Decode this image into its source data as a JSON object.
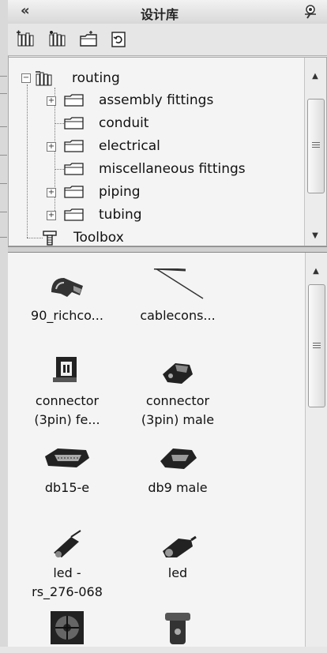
{
  "header": {
    "collapse_glyph": "«",
    "title": "设计库",
    "pin_icon": "pushpin-icon"
  },
  "toolbar": {
    "buttons": [
      {
        "name": "add-to-library-button",
        "icon": "library-add-icon"
      },
      {
        "name": "add-file-location-button",
        "icon": "library-location-icon"
      },
      {
        "name": "create-new-folder-button",
        "icon": "new-folder-icon"
      },
      {
        "name": "refresh-button",
        "icon": "refresh-icon"
      }
    ]
  },
  "tree": {
    "root": {
      "label": "routing",
      "expanded": true,
      "expander": "−"
    },
    "children": [
      {
        "label": "assembly fittings",
        "expander": "+"
      },
      {
        "label": "conduit",
        "expander": ""
      },
      {
        "label": "electrical",
        "expander": "+"
      },
      {
        "label": "miscellaneous fittings",
        "expander": ""
      },
      {
        "label": "piping",
        "expander": "+"
      },
      {
        "label": "tubing",
        "expander": "+"
      }
    ],
    "sibling": {
      "label": "Toolbox"
    }
  },
  "gallery": {
    "items": [
      {
        "line1": "90_richco...",
        "line2": "",
        "icon": "clamp-part-icon"
      },
      {
        "line1": "cablecons...",
        "line2": "",
        "icon": "cable-line-icon"
      },
      {
        "line1": "connector",
        "line2": "(3pin) fe...",
        "icon": "connector-female-icon"
      },
      {
        "line1": "connector",
        "line2": "(3pin) male",
        "icon": "connector-male-icon"
      },
      {
        "line1": "db15-e",
        "line2": "",
        "icon": "db15-connector-icon"
      },
      {
        "line1": "db9 male",
        "line2": "",
        "icon": "db9-connector-icon"
      },
      {
        "line1": "led -",
        "line2": "rs_276-068",
        "icon": "led-rs-icon"
      },
      {
        "line1": "led",
        "line2": "",
        "icon": "led-icon"
      },
      {
        "line1": "",
        "line2": "",
        "icon": "fan-icon"
      },
      {
        "line1": "",
        "line2": "",
        "icon": "bracket-part-icon"
      }
    ]
  },
  "colors": {
    "background": "#e6e6e6",
    "pane": "#f4f4f4",
    "border": "#a8a8a8"
  }
}
